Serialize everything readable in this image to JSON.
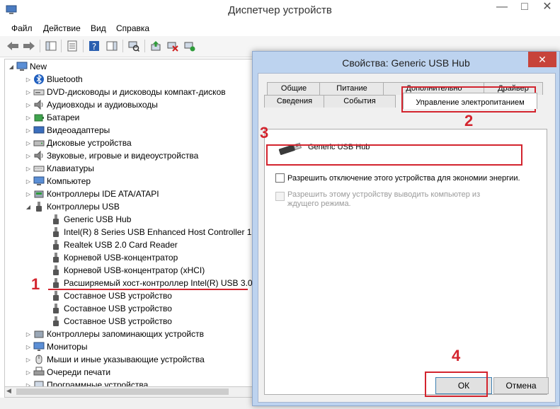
{
  "window": {
    "title": "Диспетчер устройств",
    "min": "—",
    "max": "□",
    "close": "✕"
  },
  "menu": [
    "Файл",
    "Действие",
    "Вид",
    "Справка"
  ],
  "tree": {
    "root": "New",
    "categories": [
      "Bluetooth",
      "DVD-дисководы и дисководы компакт-дисков",
      "Аудиовходы и аудиовыходы",
      "Батареи",
      "Видеоадаптеры",
      "Дисковые устройства",
      "Звуковые, игровые и видеоустройства",
      "Клавиатуры",
      "Компьютер",
      "Контроллеры IDE ATA/ATAPI",
      "Контроллеры USB"
    ],
    "usb_children": [
      "Generic USB Hub",
      "Intel(R) 8 Series USB Enhanced Host Controller 1",
      "Realtek USB 2.0 Card Reader",
      "Корневой USB-концентратор",
      "Корневой USB-концентратор (xHCI)",
      "Расширяемый хост-контроллер Intel(R) USB 3.0",
      "Составное USB устройство",
      "Составное USB устройство",
      "Составное USB устройство"
    ],
    "categories_after": [
      "Контроллеры запоминающих устройств",
      "Мониторы",
      "Мыши и иные указывающие устройства",
      "Очереди печати",
      "Программные устройства"
    ]
  },
  "dialog": {
    "title": "Свойства: Generic USB Hub",
    "close": "✕",
    "tabs_back": [
      "Общие",
      "Питание",
      "Дополнительно",
      "Драйвер"
    ],
    "tabs_front": [
      "Сведения",
      "События"
    ],
    "active_tab": "Управление электропитанием",
    "device_name": "Generic USB Hub",
    "option1": "Разрешить отключение этого устройства для экономии энергии.",
    "option2": "Разрешить этому устройству выводить компьютер из ждущего режима.",
    "ok": "ОК",
    "cancel": "Отмена"
  },
  "annotations": {
    "n1": "1",
    "n2": "2",
    "n3": "3",
    "n4": "4",
    "color": "#d3242e"
  }
}
